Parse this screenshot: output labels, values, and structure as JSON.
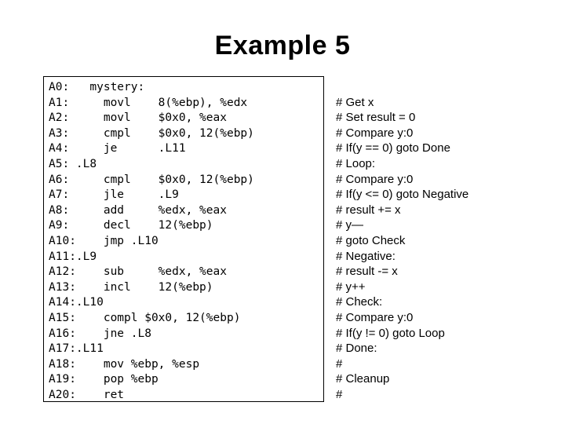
{
  "slide": {
    "title": "Example 5"
  },
  "code_block": {
    "lines": [
      "A0:   mystery:",
      "A1:     movl    8(%ebp), %edx",
      "A2:     movl    $0x0, %eax",
      "A3:     cmpl    $0x0, 12(%ebp)",
      "A4:     je      .L11",
      "A5: .L8",
      "A6:     cmpl    $0x0, 12(%ebp)",
      "A7:     jle     .L9",
      "A8:     add     %edx, %eax",
      "A9:     decl    12(%ebp)",
      "A10:    jmp .L10",
      "A11:.L9",
      "A12:    sub     %edx, %eax",
      "A13:    incl    12(%ebp)",
      "A14:.L10",
      "A15:    compl $0x0, 12(%ebp)",
      "A16:    jne .L8",
      "A17:.L11",
      "A18:    mov %ebp, %esp",
      "A19:    pop %ebp",
      "A20:    ret"
    ]
  },
  "comments": {
    "lines": [
      "# Get x",
      "# Set result = 0",
      "# Compare y:0",
      "# If(y == 0) goto Done",
      "# Loop:",
      "# Compare y:0",
      "# If(y <= 0) goto Negative",
      "# result += x",
      "# y—",
      "# goto Check",
      "# Negative:",
      "# result -= x",
      "# y++",
      "# Check:",
      "# Compare y:0",
      "# If(y != 0) goto Loop",
      "# Done:",
      "#",
      "# Cleanup",
      "#"
    ]
  },
  "colors": {
    "background": "#ffffff",
    "text": "#000000",
    "border": "#000000"
  }
}
